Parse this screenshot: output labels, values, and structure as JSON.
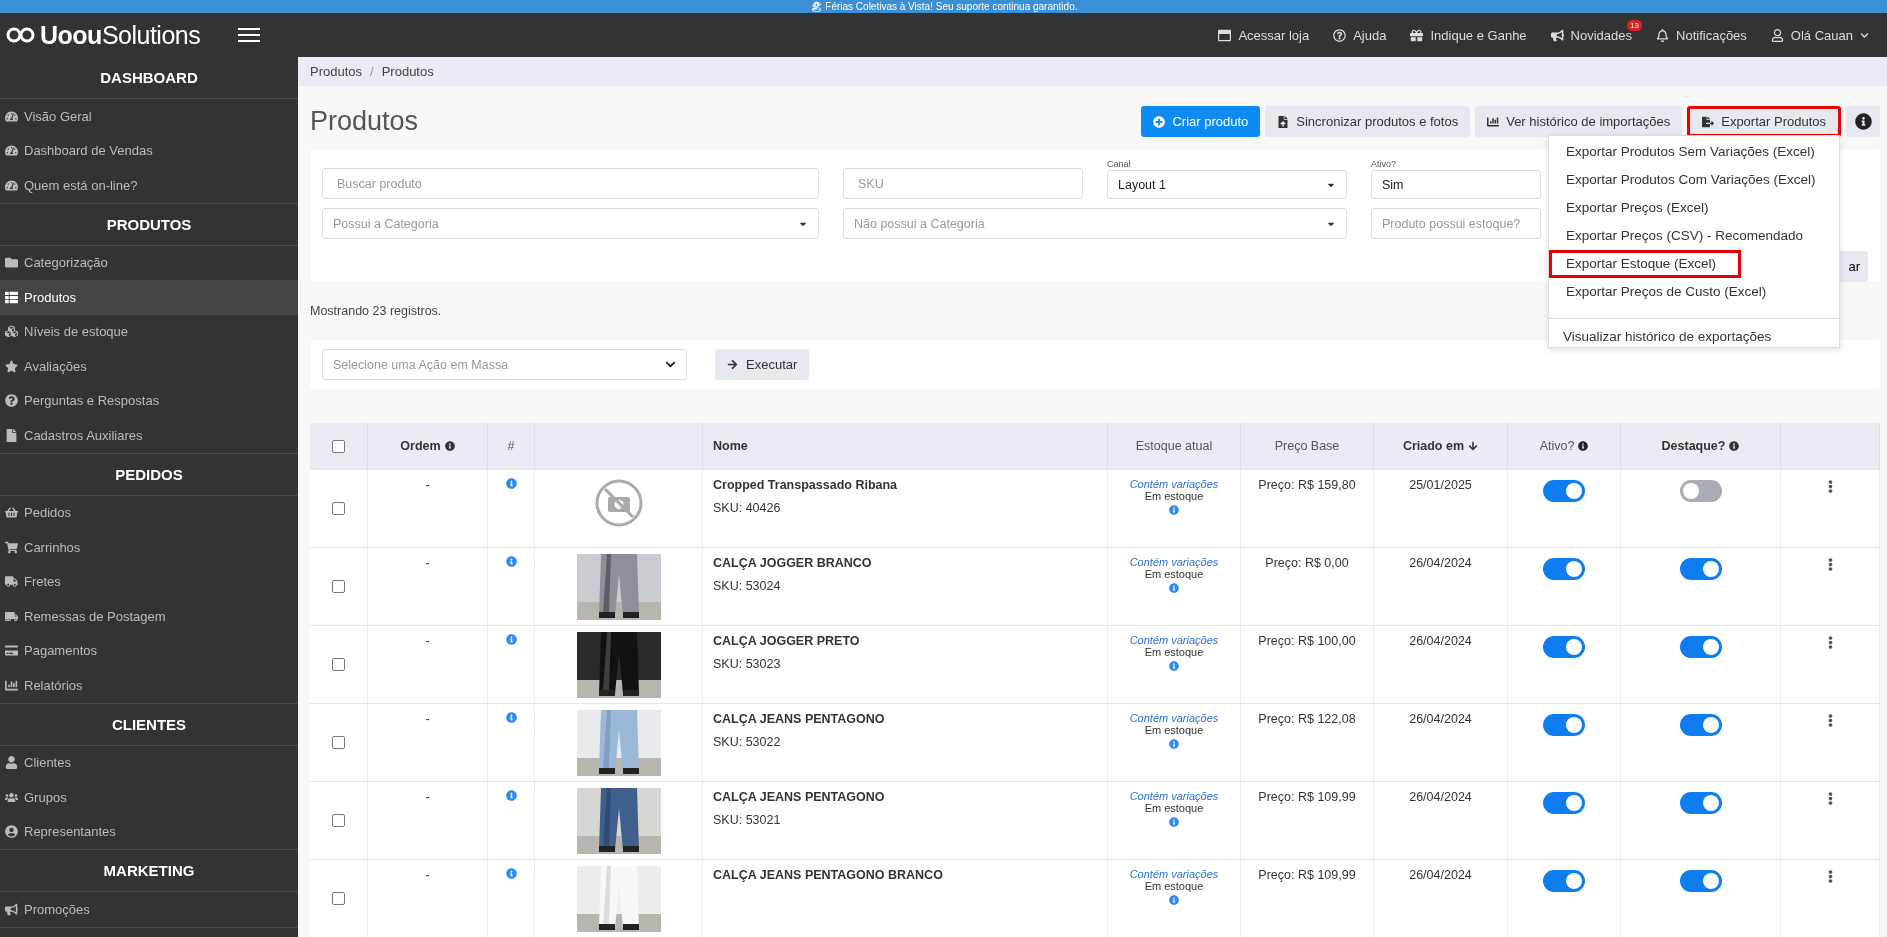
{
  "banner": {
    "text": "🏖 Férias Coletivas à Vista! Seu suporte continua garantido."
  },
  "topbar": {
    "logo": "**Uoou**Solutions",
    "links": [
      {
        "label": "Acessar loja"
      },
      {
        "label": "Ajuda"
      },
      {
        "label": "Indique e Ganhe"
      },
      {
        "label": "Novidades",
        "badge": "13"
      },
      {
        "label": "Notificações"
      },
      {
        "label": "Olá Cauan"
      }
    ]
  },
  "sidebar": {
    "sections": [
      {
        "title": "DASHBOARD",
        "items": [
          {
            "label": "Visão Geral",
            "selected": false
          },
          {
            "label": "Dashboard de Vendas",
            "selected": false
          },
          {
            "label": "Quem está on-line?",
            "selected": false
          }
        ]
      },
      {
        "title": "PRODUTOS",
        "items": [
          {
            "label": "Categorização",
            "selected": false
          },
          {
            "label": "Produtos",
            "selected": true
          },
          {
            "label": "Níveis de estoque",
            "selected": false
          },
          {
            "label": "Avaliações",
            "selected": false
          },
          {
            "label": "Perguntas e Respostas",
            "selected": false
          },
          {
            "label": "Cadastros Auxiliares",
            "selected": false
          }
        ]
      },
      {
        "title": "PEDIDOS",
        "items": [
          {
            "label": "Pedidos",
            "selected": false
          },
          {
            "label": "Carrinhos",
            "selected": false
          },
          {
            "label": "Fretes",
            "selected": false
          },
          {
            "label": "Remessas de Postagem",
            "selected": false
          },
          {
            "label": "Pagamentos",
            "selected": false
          },
          {
            "label": "Relatórios",
            "selected": false
          }
        ]
      },
      {
        "title": "CLIENTES",
        "items": [
          {
            "label": "Clientes",
            "selected": false
          },
          {
            "label": "Grupos",
            "selected": false
          },
          {
            "label": "Representantes",
            "selected": false
          }
        ]
      },
      {
        "title": "MARKETING",
        "items": [
          {
            "label": "Promoções",
            "selected": false
          }
        ]
      }
    ]
  },
  "breadcrumb": {
    "items": [
      "Produtos",
      "Produtos"
    ],
    "separator": "/"
  },
  "page_title": "Produtos",
  "actions": [
    {
      "label": "Criar produto",
      "kind": "primary"
    },
    {
      "label": "Sincronizar produtos e fotos",
      "kind": "secondary"
    },
    {
      "label": "Ver histórico de importações",
      "kind": "secondary"
    },
    {
      "label": "Exportar Produtos",
      "kind": "highlighted"
    }
  ],
  "export_menu": {
    "items": [
      {
        "label": "Exportar Produtos Sem Variações (Excel)",
        "highlighted": false
      },
      {
        "label": "Exportar Produtos Com Variações (Excel)",
        "highlighted": false
      },
      {
        "label": "Exportar Preços (Excel)",
        "highlighted": false
      },
      {
        "label": "Exportar Preços (CSV) - Recomendado",
        "highlighted": false
      },
      {
        "label": "Exportar Estoque (Excel)",
        "highlighted": true
      },
      {
        "label": "Exportar Preços de Custo (Excel)",
        "highlighted": false
      }
    ],
    "footer": "Visualizar histórico de exportações"
  },
  "filters": {
    "search": {
      "placeholder": "Buscar produto"
    },
    "sku": {
      "placeholder": "SKU"
    },
    "canal": {
      "label": "Canal",
      "value": "Layout 1"
    },
    "ativo": {
      "label": "Ativo?",
      "value": "Sim"
    },
    "has_category": {
      "placeholder": "Possui a Categoria"
    },
    "not_category": {
      "placeholder": "Não possui a Categoria"
    },
    "stock": {
      "placeholder": "Produto possui estoque?"
    },
    "submit": "ar"
  },
  "count_text": "Mostrando 23 registros.",
  "mass_action": {
    "placeholder": "Selecione uma Ação em Massa",
    "button": "Executar"
  },
  "table": {
    "select_all": {
      "checked": false
    },
    "columns": [
      "Ordem",
      "#",
      "Nome",
      "Estoque atual",
      "Preço Base",
      "Criado em",
      "Ativo?",
      "Destaque?"
    ],
    "rows": [
      {
        "checked": false,
        "ordem": "-",
        "image": {
          "kind": "placeholder"
        },
        "name": "Cropped Transpassado Ribana",
        "sku": "SKU: 40426",
        "variations": "Contém variações",
        "stock": "Em estoque",
        "price": "Preço: R$ 159,80",
        "created": "25/01/2025",
        "active": true,
        "featured": false
      },
      {
        "checked": false,
        "ordem": "-",
        "name": "CALÇA JOGGER BRANCO",
        "sku": "SKU: 53024",
        "variations": "Contém variações",
        "stock": "Em estoque",
        "price": "Preço: R$ 0,00",
        "created": "26/04/2024",
        "active": true,
        "featured": true
      },
      {
        "checked": false,
        "ordem": "-",
        "name": "CALÇA JOGGER PRETO",
        "sku": "SKU: 53023",
        "variations": "Contém variações",
        "stock": "Em estoque",
        "price": "Preço: R$ 100,00",
        "created": "26/04/2024",
        "active": true,
        "featured": true
      },
      {
        "checked": false,
        "ordem": "-",
        "name": "CALÇA JEANS PENTAGONO",
        "sku": "SKU: 53022",
        "variations": "Contém variações",
        "stock": "Em estoque",
        "price": "Preço: R$ 122,08",
        "created": "26/04/2024",
        "active": true,
        "featured": true
      },
      {
        "checked": false,
        "ordem": "-",
        "name": "CALÇA JEANS PENTAGONO",
        "sku": "SKU: 53021",
        "variations": "Contém variações",
        "stock": "Em estoque",
        "price": "Preço: R$ 109,99",
        "created": "26/04/2024",
        "active": true,
        "featured": true
      },
      {
        "checked": false,
        "ordem": "-",
        "name": "CALÇA JEANS PENTAGONO BRANCO",
        "variations": "Contém variações",
        "stock": "Em estoque",
        "price": "Preço: R$ 109,99",
        "created": "26/04/2024",
        "active": true,
        "featured": true
      }
    ]
  }
}
